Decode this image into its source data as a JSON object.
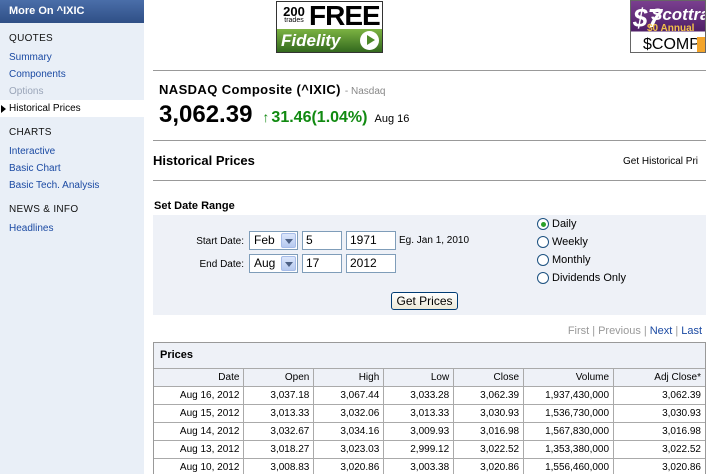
{
  "sidebar": {
    "header": "More On ^IXIC",
    "sections": [
      {
        "title": "QUOTES",
        "items": [
          {
            "label": "Summary",
            "state": "link"
          },
          {
            "label": "Components",
            "state": "link"
          },
          {
            "label": "Options",
            "state": "disabled"
          },
          {
            "label": "Historical Prices",
            "state": "active"
          }
        ]
      },
      {
        "title": "CHARTS",
        "items": [
          {
            "label": "Interactive",
            "state": "link"
          },
          {
            "label": "Basic Chart",
            "state": "link"
          },
          {
            "label": "Basic Tech. Analysis",
            "state": "link"
          }
        ]
      },
      {
        "title": "NEWS & INFO",
        "items": [
          {
            "label": "Headlines",
            "state": "link"
          }
        ]
      }
    ]
  },
  "ads": {
    "fidelity": {
      "count": "200",
      "count_sub": "trades",
      "headline": "FREE",
      "brand": "Fidelity"
    },
    "scottrade": {
      "number": "$7",
      "brand": "Scottra",
      "annual": "$0 Annual",
      "comp": "$COMP"
    }
  },
  "quote": {
    "name": "NASDAQ Composite (^IXIC)",
    "exchange": "- Nasdaq",
    "price": "3,062.39",
    "change": "31.46(1.04%)",
    "date": "Aug 16",
    "up_color": "#118a11"
  },
  "historical": {
    "title": "Historical Prices",
    "get_label": "Get Historical Pri"
  },
  "form": {
    "heading": "Set Date Range",
    "start_label": "Start Date:",
    "start_month": "Feb",
    "start_day": "5",
    "start_year": "1971",
    "hint": "Eg. Jan 1, 2010",
    "end_label": "End Date:",
    "end_month": "Aug",
    "end_day": "17",
    "end_year": "2012",
    "frequency": [
      {
        "label": "Daily",
        "selected": true
      },
      {
        "label": "Weekly",
        "selected": false
      },
      {
        "label": "Monthly",
        "selected": false
      },
      {
        "label": "Dividends Only",
        "selected": false
      }
    ],
    "button": "Get Prices"
  },
  "pager": {
    "first": "First",
    "previous": "Previous",
    "next": "Next",
    "last": "Last",
    "sep": "|"
  },
  "prices": {
    "title": "Prices",
    "columns": [
      "Date",
      "Open",
      "High",
      "Low",
      "Close",
      "Volume",
      "Adj Close*"
    ],
    "rows": [
      [
        "Aug 16, 2012",
        "3,037.18",
        "3,067.44",
        "3,033.28",
        "3,062.39",
        "1,937,430,000",
        "3,062.39"
      ],
      [
        "Aug 15, 2012",
        "3,013.33",
        "3,032.06",
        "3,013.33",
        "3,030.93",
        "1,536,730,000",
        "3,030.93"
      ],
      [
        "Aug 14, 2012",
        "3,032.67",
        "3,034.16",
        "3,009.93",
        "3,016.98",
        "1,567,830,000",
        "3,016.98"
      ],
      [
        "Aug 13, 2012",
        "3,018.27",
        "3,023.03",
        "2,999.12",
        "3,022.52",
        "1,353,380,000",
        "3,022.52"
      ],
      [
        "Aug 10, 2012",
        "3,008.83",
        "3,020.86",
        "3,003.38",
        "3,020.86",
        "1,556,460,000",
        "3,020.86"
      ]
    ]
  }
}
